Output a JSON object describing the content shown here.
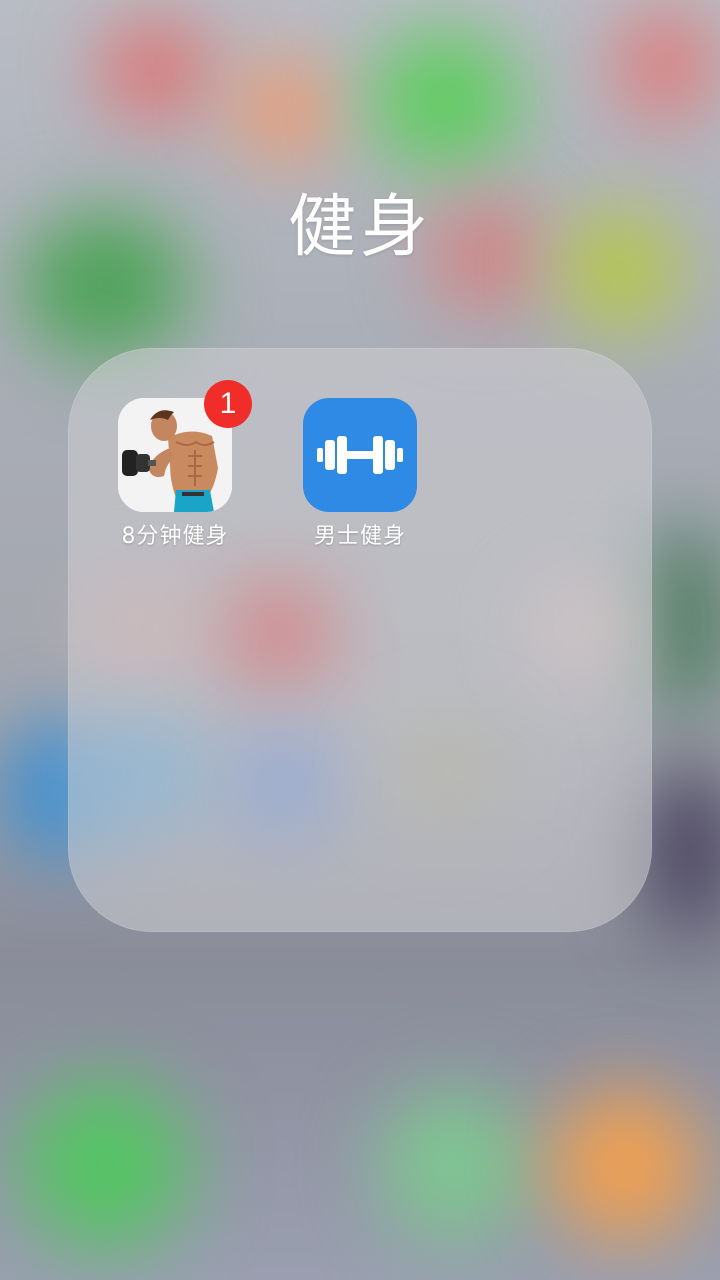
{
  "folder": {
    "title": "健身"
  },
  "apps": [
    {
      "label": "8分钟健身",
      "icon": "bodybuilder-dumbbell-icon",
      "badge": "1"
    },
    {
      "label": "男士健身",
      "icon": "barbell-icon",
      "icon_color": "#2f8ae6"
    }
  ],
  "colors": {
    "badge": "#f12d2a",
    "folder_panel": "rgba(205,205,210,0.55)",
    "text": "#ffffff"
  }
}
